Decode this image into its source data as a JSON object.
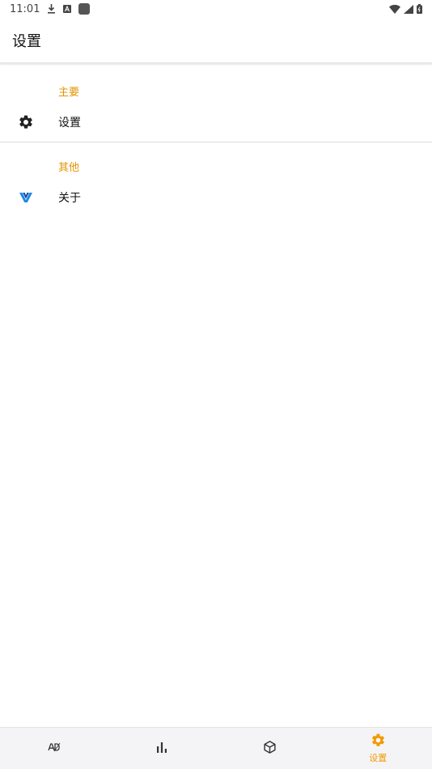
{
  "status_bar": {
    "time": "11:01"
  },
  "app_bar": {
    "title": "设置"
  },
  "sections": [
    {
      "header": "主要",
      "items": [
        {
          "label": "设置",
          "icon": "gear-icon"
        }
      ]
    },
    {
      "header": "其他",
      "items": [
        {
          "label": "关于",
          "icon": "v-logo-icon"
        }
      ]
    }
  ],
  "bottom_nav": {
    "items": [
      {
        "icon": "ad-icon",
        "label": ""
      },
      {
        "icon": "bar-chart-icon",
        "label": ""
      },
      {
        "icon": "package-icon",
        "label": ""
      },
      {
        "icon": "gear-icon",
        "label": "设置",
        "active": true
      }
    ]
  },
  "colors": {
    "accent": "#f29a00",
    "section_header": "#e39400",
    "logo_blue": "#1e88e5"
  }
}
